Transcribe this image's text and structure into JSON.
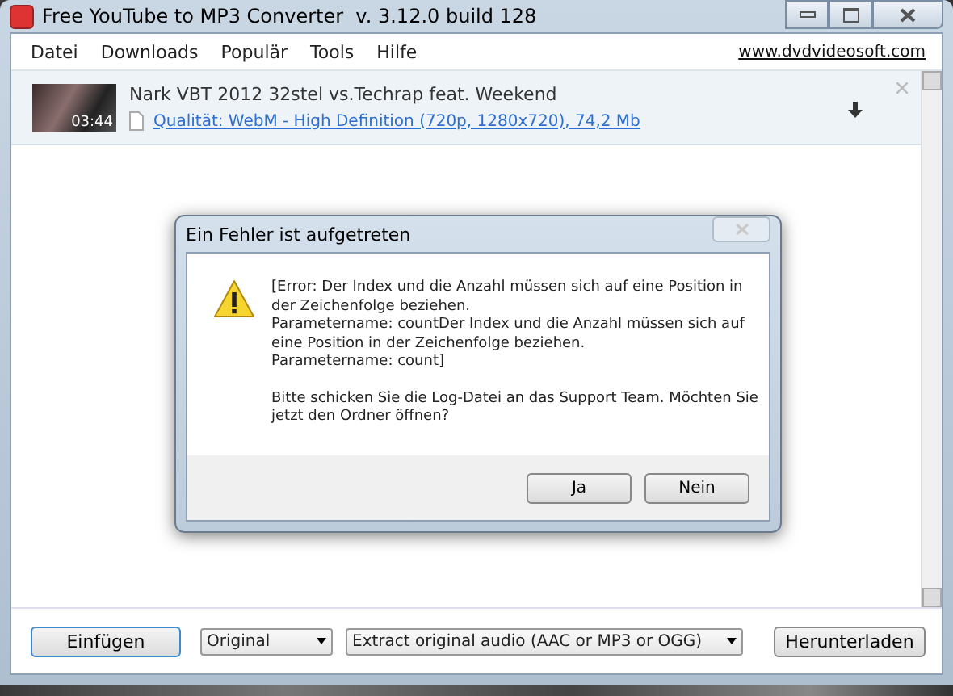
{
  "window": {
    "title": "Free YouTube to MP3 Converter  v. 3.12.0 build 128"
  },
  "menu": {
    "items": [
      "Datei",
      "Downloads",
      "Populär",
      "Tools",
      "Hilfe"
    ],
    "link": "www.dvdvideosoft.com"
  },
  "video": {
    "duration": "03:44",
    "title": "Nark VBT 2012 32stel vs.Techrap feat. Weekend",
    "quality": "Qualität: WebM - High Definition (720p, 1280x720), 74,2 Mb"
  },
  "dialog": {
    "title": "Ein Fehler ist aufgetreten",
    "error_paragraphs": [
      "[Error: Der Index und die Anzahl müssen sich auf eine Position in der Zeichenfolge beziehen.",
      "Parametername: countDer Index und die Anzahl müssen sich auf eine Position in der Zeichenfolge beziehen.",
      "Parametername: count]"
    ],
    "question": "Bitte schicken Sie die Log-Datei an das Support Team. Möchten Sie jetzt den Ordner öffnen?",
    "buttons": [
      "Ja",
      "Nein"
    ]
  },
  "bottom": {
    "paste_button": "Einfügen",
    "format": "Original",
    "mode": "Extract original audio (AAC or MP3 or OGG)",
    "download_button": "Herunterladen"
  }
}
